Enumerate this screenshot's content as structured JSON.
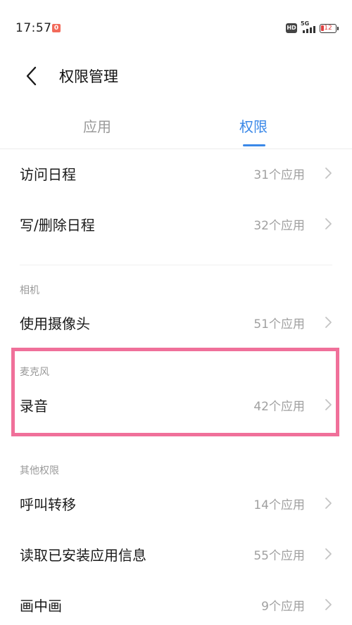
{
  "status_bar": {
    "time": "17:57",
    "notification_badge": "0",
    "hd": "HD",
    "network": "5G",
    "battery": "12"
  },
  "header": {
    "title": "权限管理"
  },
  "tabs": [
    {
      "label": "应用",
      "active": false
    },
    {
      "label": "权限",
      "active": true
    }
  ],
  "sections": {
    "calendar": {
      "rows": [
        {
          "label": "访问日程",
          "count": "31个应用"
        },
        {
          "label": "写/删除日程",
          "count": "32个应用"
        }
      ]
    },
    "camera": {
      "label": "相机",
      "rows": [
        {
          "label": "使用摄像头",
          "count": "51个应用"
        }
      ]
    },
    "microphone": {
      "label": "麦克风",
      "rows": [
        {
          "label": "录音",
          "count": "42个应用"
        }
      ]
    },
    "other": {
      "label": "其他权限",
      "rows": [
        {
          "label": "呼叫转移",
          "count": "14个应用"
        },
        {
          "label": "读取已安装应用信息",
          "count": "55个应用"
        },
        {
          "label": "画中画",
          "count": "9个应用"
        }
      ]
    }
  },
  "colors": {
    "accent": "#3a88e8",
    "highlight_border": "#f0709a",
    "secondary_text": "#a0a0a0"
  }
}
